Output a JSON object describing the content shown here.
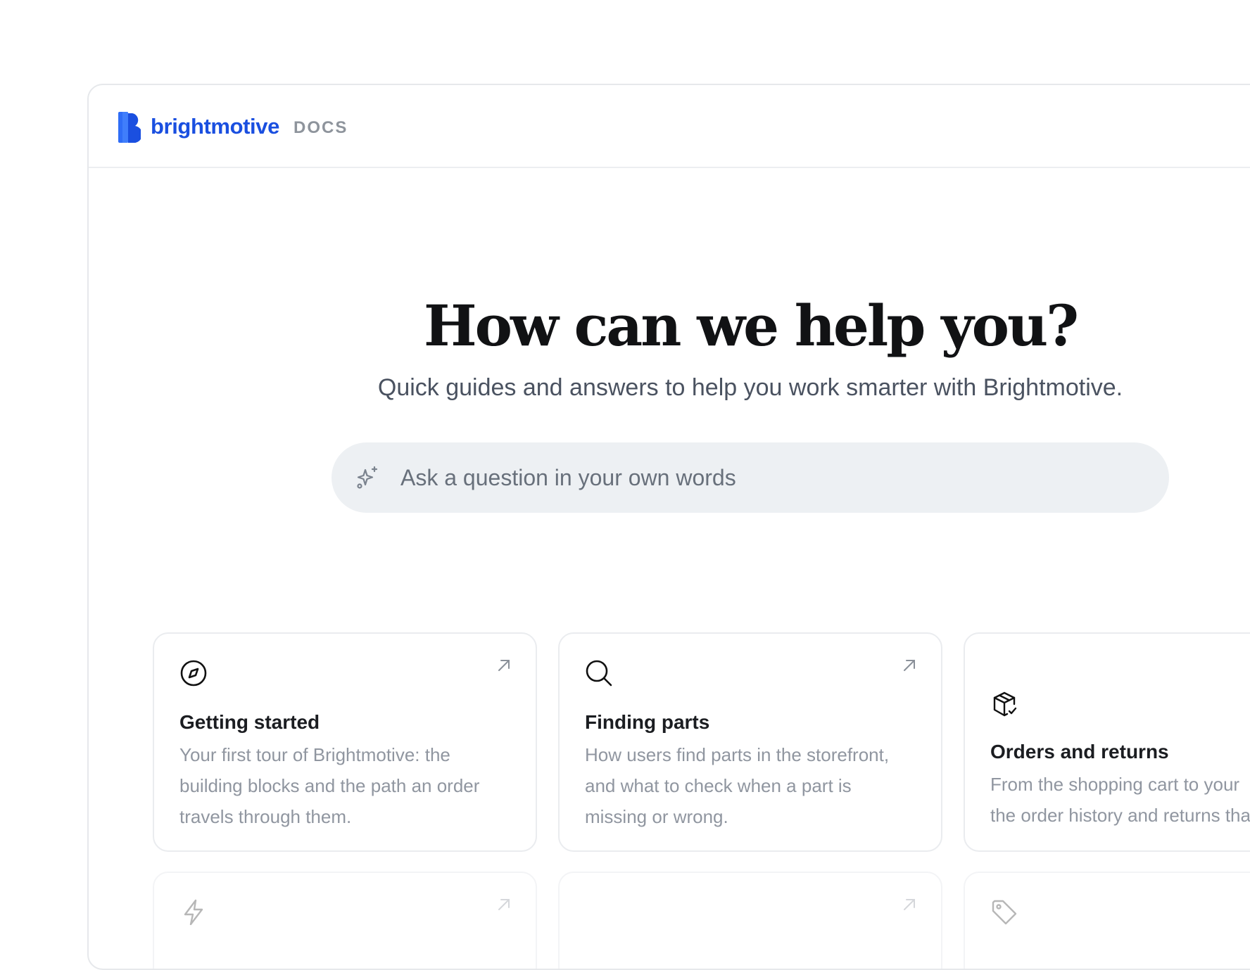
{
  "brand": {
    "name": "brightmotive",
    "suffix": "DOCS",
    "color": "#1a4fe0"
  },
  "hero": {
    "title": "How can we help you?",
    "subtitle": "Quick guides and answers to help you work smarter with Brightmotive."
  },
  "search": {
    "placeholder": "Ask a question in your own words",
    "icon": "sparkles-icon"
  },
  "cards": [
    {
      "icon": "compass-icon",
      "title": "Getting started",
      "description": "Your first tour of Brightmotive: the building blocks and the path an order travels through them."
    },
    {
      "icon": "search-icon",
      "title": "Finding parts",
      "description": "How users find parts in the storefront, and what to check when a part is missing or wrong."
    },
    {
      "icon": "package-check-icon",
      "title": "Orders and returns",
      "description_line1": "From the shopping cart to your",
      "description_line2": "the order history and returns tha"
    }
  ],
  "faded_cards": [
    {
      "icon": "lightning-icon"
    },
    {
      "icon": ""
    },
    {
      "icon": "tag-icon"
    }
  ]
}
